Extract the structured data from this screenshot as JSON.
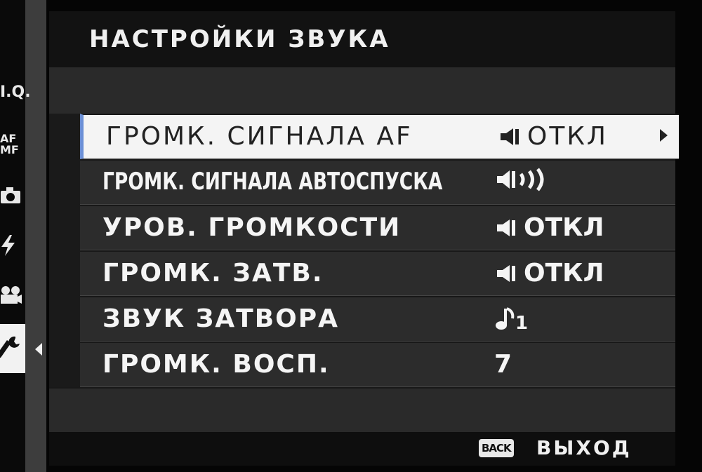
{
  "header": {
    "title": "НАСТРОЙКИ ЗВУКА"
  },
  "sidebar": {
    "items": [
      {
        "label": "I.Q.",
        "icon": "image-quality-icon"
      },
      {
        "label": "AF MF",
        "icon": "af-mf-icon"
      },
      {
        "label": "",
        "icon": "camera-icon"
      },
      {
        "label": "",
        "icon": "flash-icon"
      },
      {
        "label": "",
        "icon": "movie-icon"
      },
      {
        "label": "",
        "icon": "wrench-icon",
        "active": true
      }
    ]
  },
  "menu": {
    "items": [
      {
        "label": "ГРОМК. СИГНАЛА AF",
        "value": "ОТКЛ",
        "icon": "speaker-icon",
        "selected": true
      },
      {
        "label": "ГРОМК. СИГНАЛА АВТОСПУСКА",
        "value": "",
        "icon": "speaker-loud-icon"
      },
      {
        "label": "УРОВ. ГРОМКОСТИ",
        "value": "ОТКЛ",
        "icon": "speaker-icon"
      },
      {
        "label": "ГРОМК. ЗАТВ.",
        "value": "ОТКЛ",
        "icon": "speaker-icon"
      },
      {
        "label": "ЗВУК ЗАТВОРА",
        "value": "1",
        "icon": "music-note-icon"
      },
      {
        "label": "ГРОМК. ВОСП.",
        "value": "7",
        "icon": ""
      }
    ]
  },
  "footer": {
    "back_badge": "BACK",
    "exit_label": "ВЫХОД"
  },
  "colors": {
    "selection_accent": "#6b8fd6",
    "selected_bg": "#f4f4f4",
    "row_bg": "#2c2c2c"
  }
}
